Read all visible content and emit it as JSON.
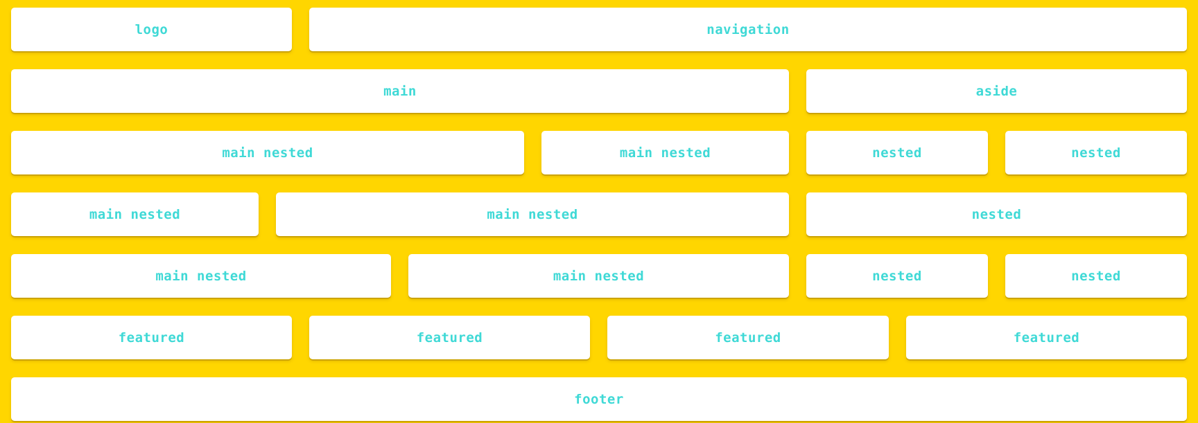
{
  "colors": {
    "background": "#FFD600",
    "box": "#FFFFFF",
    "text": "#3FD9D6"
  },
  "header": {
    "logo": "logo",
    "navigation": "navigation"
  },
  "content": {
    "main": "main",
    "aside": "aside"
  },
  "row3": {
    "main_nested_1": "main nested",
    "main_nested_2": "main nested",
    "nested_1": "nested",
    "nested_2": "nested"
  },
  "row4": {
    "main_nested_1": "main nested",
    "main_nested_2": "main nested",
    "nested_1": "nested"
  },
  "row5": {
    "main_nested_1": "main nested",
    "main_nested_2": "main nested",
    "nested_1": "nested",
    "nested_2": "nested"
  },
  "featured": [
    "featured",
    "featured",
    "featured",
    "featured"
  ],
  "footer": "footer"
}
